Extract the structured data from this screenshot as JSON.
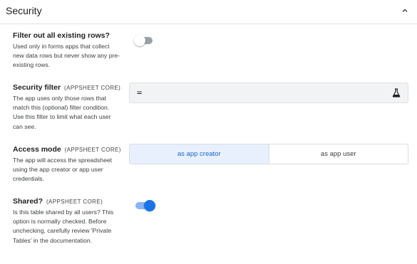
{
  "section": {
    "title": "Security",
    "icon": "chevron-up-icon"
  },
  "fields": {
    "filter_rows": {
      "label": "Filter out all existing rows?",
      "description": "Used only in forms apps that collect new data rows but never show any pre-existing rows.",
      "enabled": false
    },
    "security_filter": {
      "label": "Security filter",
      "tag": "(APPSHEET CORE)",
      "description": "The app uses only those rows that match this (optional) filter condition. Use this filter to limit what each user can see.",
      "value": "=",
      "icon": "flask-icon"
    },
    "access_mode": {
      "label": "Access mode",
      "tag": "(APPSHEET CORE)",
      "description": "The app will access the spreadsheet using the app creator or app user credentials.",
      "options": [
        "as app creator",
        "as app user"
      ],
      "selected": "as app creator",
      "selected_color": "#1967d2"
    },
    "shared": {
      "label": "Shared?",
      "tag": "(APPSHEET CORE)",
      "description": "Is this table shared by all users? This option is normally checked. Before unchecking, carefully review 'Private Tables' in the documentation.",
      "enabled": true,
      "accent": "#1a73e8"
    }
  }
}
